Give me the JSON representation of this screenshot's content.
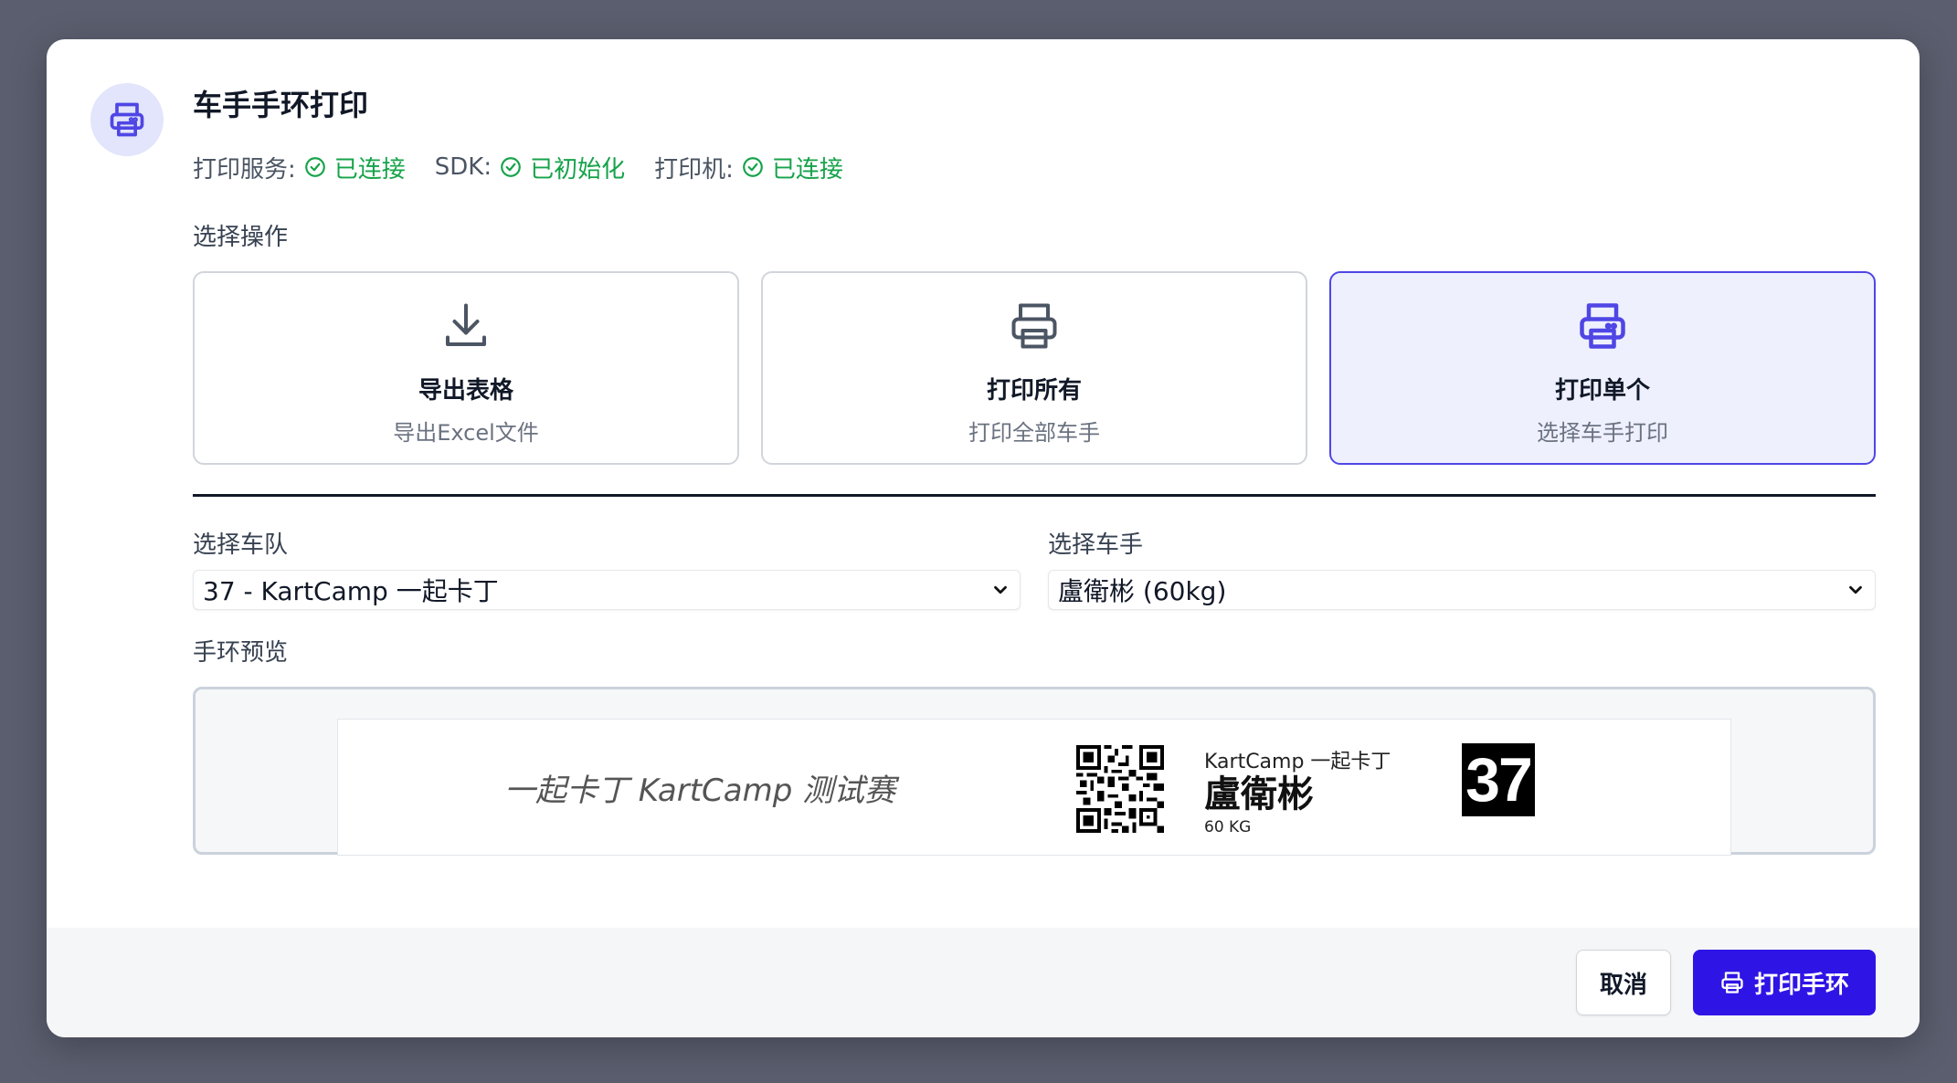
{
  "header": {
    "title": "车手手环打印",
    "icon": "printer-icon"
  },
  "status": {
    "service_label": "打印服务:",
    "service_value": "已连接",
    "sdk_label": "SDK:",
    "sdk_value": "已初始化",
    "printer_label": "打印机:",
    "printer_value": "已连接"
  },
  "operations": {
    "label": "选择操作",
    "cards": [
      {
        "title": "导出表格",
        "subtitle": "导出Excel文件",
        "icon": "download-icon"
      },
      {
        "title": "打印所有",
        "subtitle": "打印全部车手",
        "icon": "printer-icon"
      },
      {
        "title": "打印单个",
        "subtitle": "选择车手打印",
        "icon": "printer-icon",
        "selected": true
      }
    ]
  },
  "team_select": {
    "label": "选择车队",
    "value": "37 - KartCamp 一起卡丁"
  },
  "driver_select": {
    "label": "选择车手",
    "value": "盧衛彬 (60kg)"
  },
  "preview": {
    "label": "手环预览",
    "event_name": "一起卡丁 KartCamp 测试赛",
    "team_name": "KartCamp 一起卡丁",
    "driver_name": "盧衛彬",
    "weight": "60 KG",
    "kart_number": "37"
  },
  "footer": {
    "cancel_label": "取消",
    "print_label": "打印手环"
  },
  "colors": {
    "accent": "#2f14e6",
    "success": "#16a34a",
    "selected_bg": "#eef0fe",
    "selected_border": "#4f46e5"
  }
}
